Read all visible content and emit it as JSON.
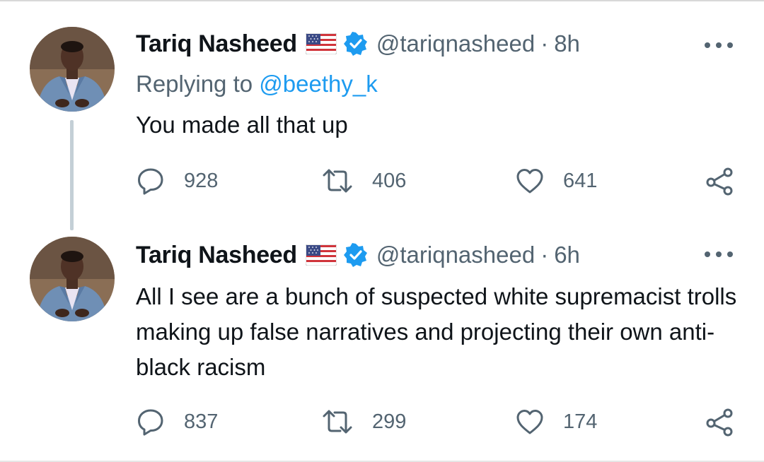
{
  "tweets": [
    {
      "author": {
        "name": "Tariq Nasheed",
        "handle": "@tariqnasheed",
        "flag_icon": "us-flag-icon",
        "verified_icon": "verified-badge-icon"
      },
      "time": "8h",
      "separator": "·",
      "replying_prefix": "Replying to ",
      "replying_to": "@beethy_k",
      "text": "You made all that up",
      "stats": {
        "replies": "928",
        "retweets": "406",
        "likes": "641"
      }
    },
    {
      "author": {
        "name": "Tariq Nasheed",
        "handle": "@tariqnasheed",
        "flag_icon": "us-flag-icon",
        "verified_icon": "verified-badge-icon"
      },
      "time": "6h",
      "separator": "·",
      "text": "All I see are a bunch of suspected white supremacist trolls making up false narratives and projecting their own anti-black racism",
      "stats": {
        "replies": "837",
        "retweets": "299",
        "likes": "174"
      }
    }
  ],
  "colors": {
    "text_primary": "#0f1419",
    "text_secondary": "#536471",
    "mention": "#1d9bf0",
    "verified": "#1d9bf0",
    "thread_line": "#c4cfd6"
  }
}
